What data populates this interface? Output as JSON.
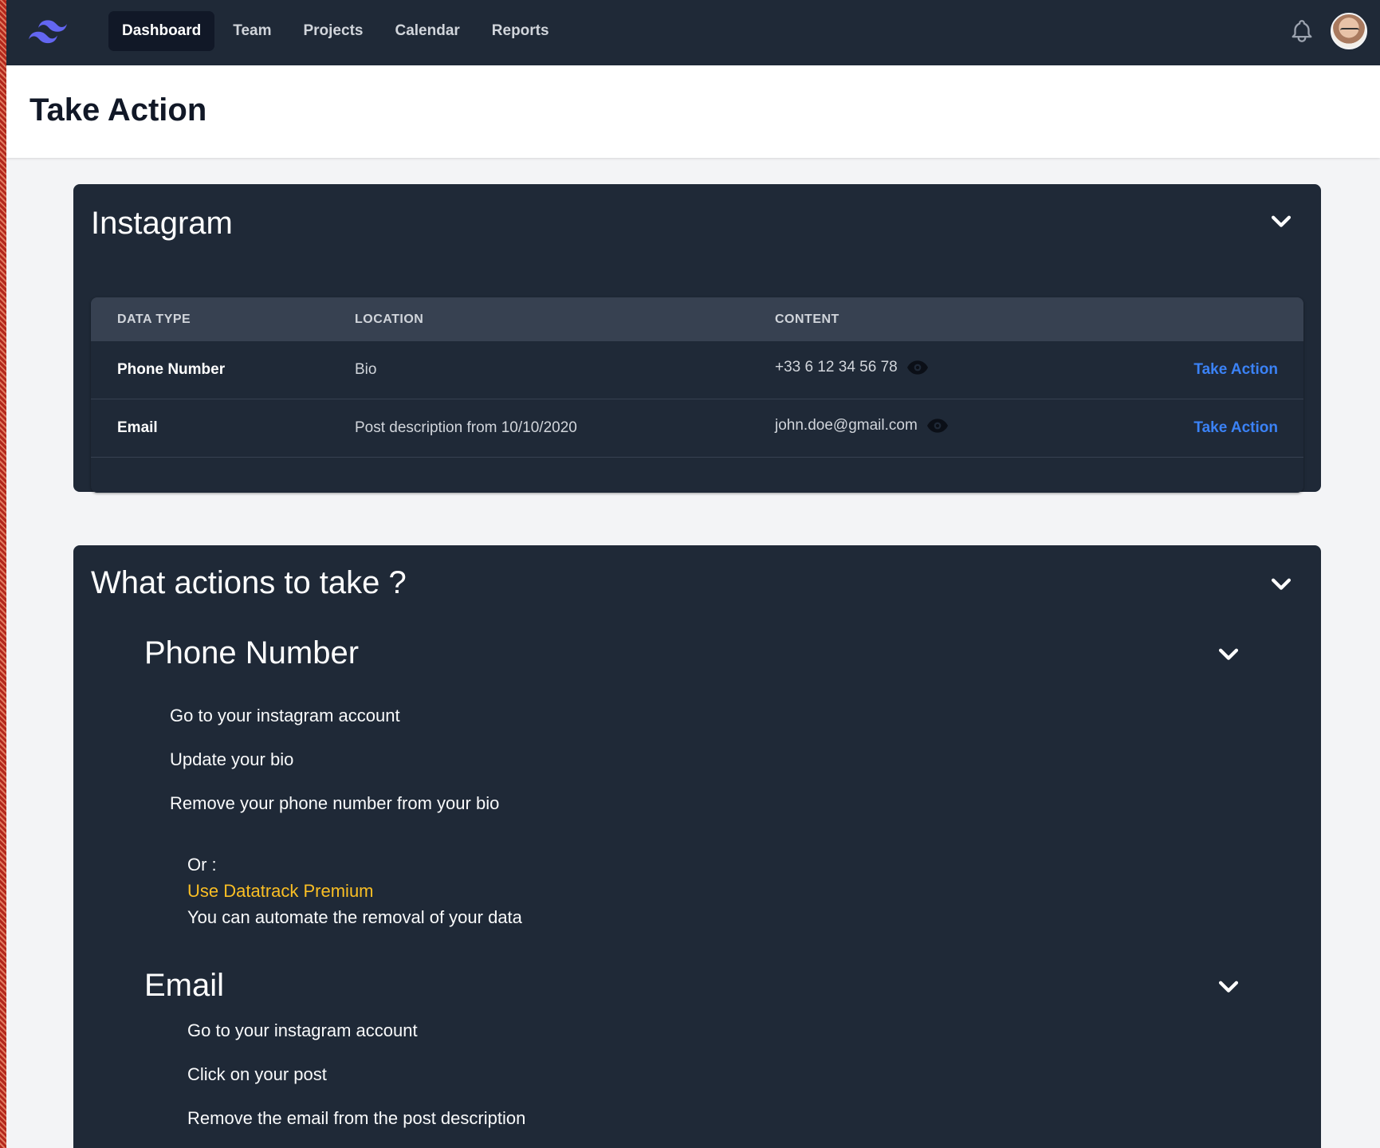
{
  "nav": {
    "links": [
      "Dashboard",
      "Team",
      "Projects",
      "Calendar",
      "Reports"
    ],
    "active": "Dashboard"
  },
  "header": {
    "title": "Take Action"
  },
  "instagram_card": {
    "title": "Instagram",
    "columns": [
      "DATA TYPE",
      "LOCATION",
      "CONTENT"
    ],
    "rows": [
      {
        "type": "Phone Number",
        "location": "Bio",
        "content": "+33 6 12 34 56 78",
        "action": "Take Action"
      },
      {
        "type": "Email",
        "location": "Post description from 10/10/2020",
        "content": "john.doe@gmail.com",
        "action": "Take Action"
      }
    ]
  },
  "actions_card": {
    "title": "What actions to take ?",
    "sections": [
      {
        "title": "Phone Number",
        "steps": [
          "Go to your instagram account",
          "Update your bio",
          "Remove your phone number from your bio"
        ],
        "or_label": "Or :",
        "premium_link": "Use Datatrack Premium",
        "premium_text": "You can automate the removal of your data"
      },
      {
        "title": "Email",
        "steps": [
          "Go to your instagram account",
          "Click on your post",
          "Remove the email from the post description"
        ]
      }
    ]
  },
  "colors": {
    "nav_bg": "#1f2937",
    "card_bg": "#1f2937",
    "table_header_bg": "#374151",
    "link_blue": "#3b82f6",
    "premium_yellow": "#fbbf24",
    "logo_indigo": "#6366f1"
  },
  "icons": {
    "logo": "tailwind-logo-icon",
    "bell": "bell-icon",
    "eye": "eye-icon",
    "chevron": "chevron-down-icon"
  }
}
